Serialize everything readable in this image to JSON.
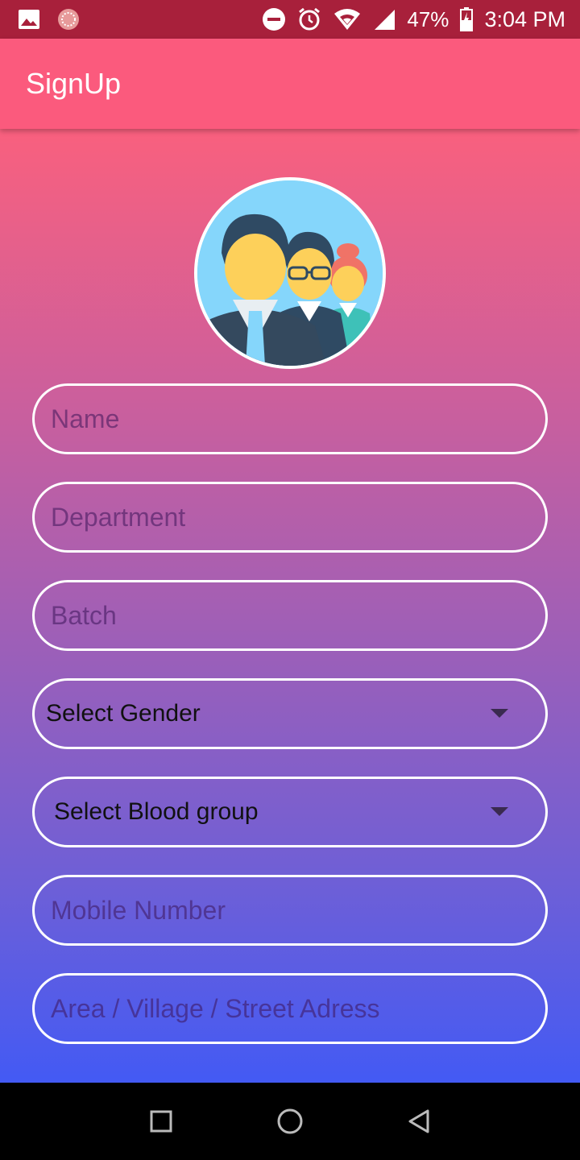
{
  "status_bar": {
    "battery_percent": "47%",
    "time": "3:04 PM",
    "icons": [
      "image-icon",
      "notification-icon",
      "do-not-disturb-icon",
      "alarm-icon",
      "wifi-icon",
      "signal-icon",
      "battery-icon"
    ]
  },
  "app_bar": {
    "title": "SignUp"
  },
  "avatar": {
    "icon": "group-avatar-icon"
  },
  "form": {
    "name": {
      "placeholder": "Name"
    },
    "department": {
      "placeholder": "Department"
    },
    "batch": {
      "placeholder": "Batch"
    },
    "gender": {
      "selected": "Select Gender"
    },
    "blood_group": {
      "selected": "Select Blood group"
    },
    "mobile": {
      "placeholder": "Mobile Number"
    },
    "address": {
      "placeholder": "Area / Village / Street Adress"
    }
  },
  "nav_bar": {
    "icons": [
      "recents-icon",
      "home-icon",
      "back-icon"
    ]
  },
  "colors": {
    "status_bar": "#a8203b",
    "app_bar": "#fb5a7d",
    "gradient_top": "#f9607e",
    "gradient_bottom": "#435af4",
    "field_border": "#ffffff"
  }
}
